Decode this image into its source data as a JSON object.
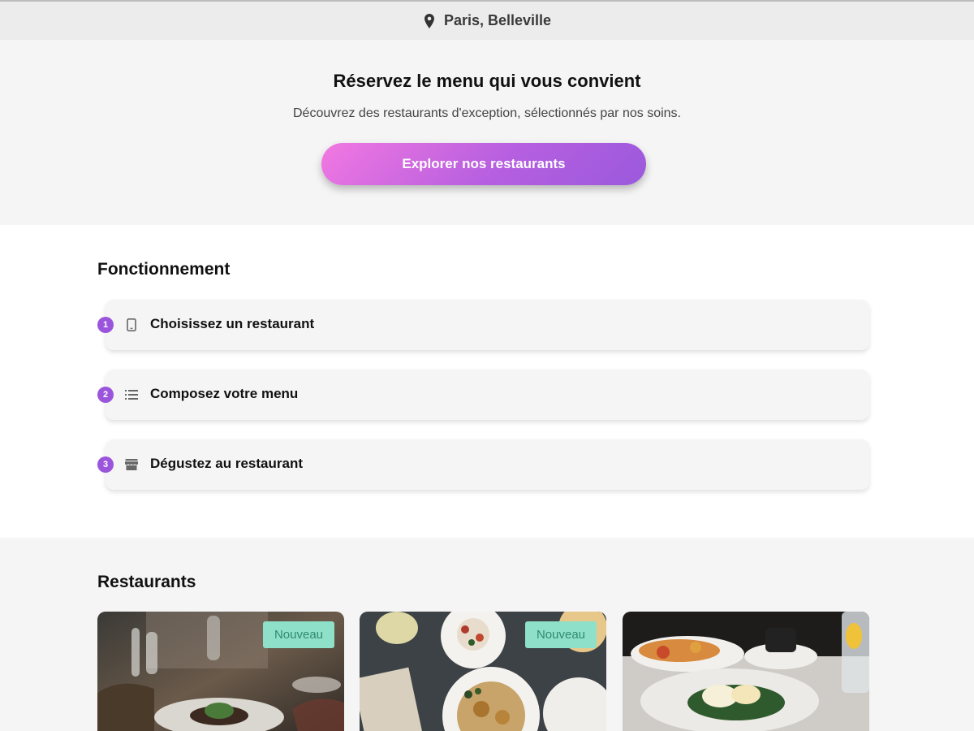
{
  "location": {
    "icon": "map-pin-icon",
    "label": "Paris, Belleville"
  },
  "hero": {
    "title": "Réservez le menu qui vous convient",
    "subtitle": "Découvrez des restaurants d'exception, sélectionnés par nos soins.",
    "cta_label": "Explorer nos restaurants"
  },
  "how_it_works": {
    "title": "Fonctionnement",
    "steps": [
      {
        "number": "1",
        "icon": "smartphone-icon",
        "label": "Choisissez un restaurant"
      },
      {
        "number": "2",
        "icon": "list-icon",
        "label": "Composez votre menu"
      },
      {
        "number": "3",
        "icon": "storefront-icon",
        "label": "Dégustez au restaurant"
      }
    ]
  },
  "restaurants": {
    "title": "Restaurants",
    "cards": [
      {
        "badge": "Nouveau",
        "photo": "restaurant-table-photo"
      },
      {
        "badge": "Nouveau",
        "photo": "dishes-overhead-photo"
      },
      {
        "badge": "",
        "photo": "brunch-plates-photo"
      }
    ]
  },
  "colors": {
    "accent": "#9b55dc",
    "cta_start": "#f278e1",
    "cta_end": "#9b59dc",
    "badge_bg": "#8fe0c8",
    "badge_text": "#2f8a6e"
  }
}
